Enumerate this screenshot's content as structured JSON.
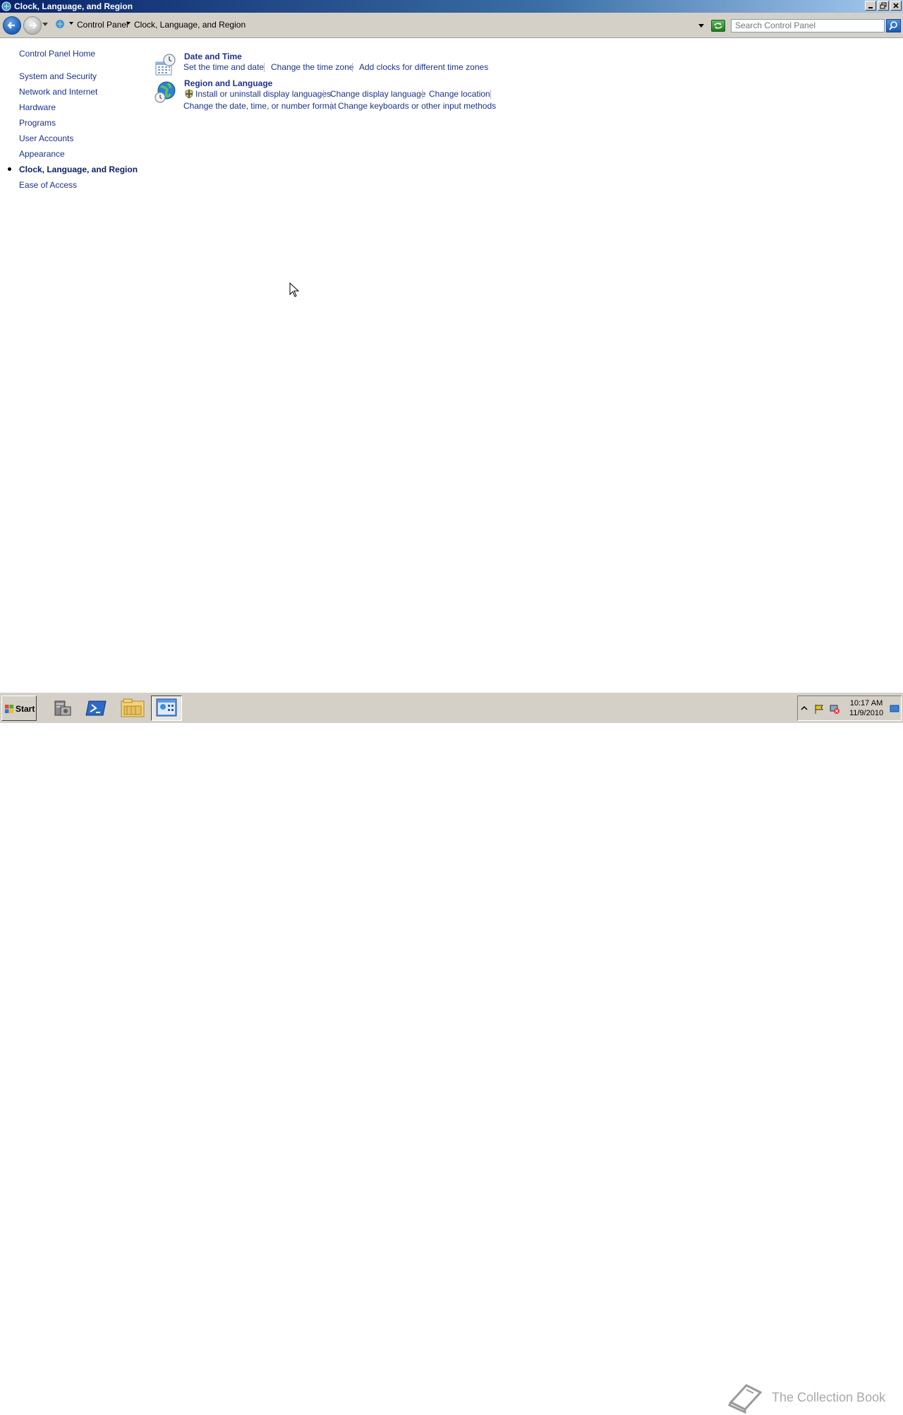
{
  "window": {
    "title": "Clock, Language, and Region"
  },
  "address_bar": {
    "breadcrumbs": [
      "Control Panel",
      "Clock, Language, and Region"
    ],
    "search_placeholder": "Search Control Panel"
  },
  "left_nav": {
    "items": [
      {
        "label": "Control Panel Home"
      },
      {
        "label": "System and Security"
      },
      {
        "label": "Network and Internet"
      },
      {
        "label": "Hardware"
      },
      {
        "label": "Programs"
      },
      {
        "label": "User Accounts"
      },
      {
        "label": "Appearance"
      },
      {
        "label": "Clock, Language, and Region",
        "current": true
      },
      {
        "label": "Ease of Access"
      }
    ]
  },
  "categories": [
    {
      "title": "Date and Time",
      "icon": "clock-calendar-icon",
      "tasks": [
        "Set the time and date",
        "Change the time zone",
        "Add clocks for different time zones"
      ]
    },
    {
      "title": "Region and Language",
      "icon": "globe-clock-icon",
      "tasks": [
        "Install or uninstall display languages",
        "Change display language",
        "Change location",
        "Change the date, time, or number format",
        "Change keyboards or other input methods"
      ]
    }
  ],
  "taskbar": {
    "start_label": "Start",
    "clock_time": "10:17 AM",
    "clock_date": "11/9/2010",
    "watermark": "The Collection Book"
  }
}
